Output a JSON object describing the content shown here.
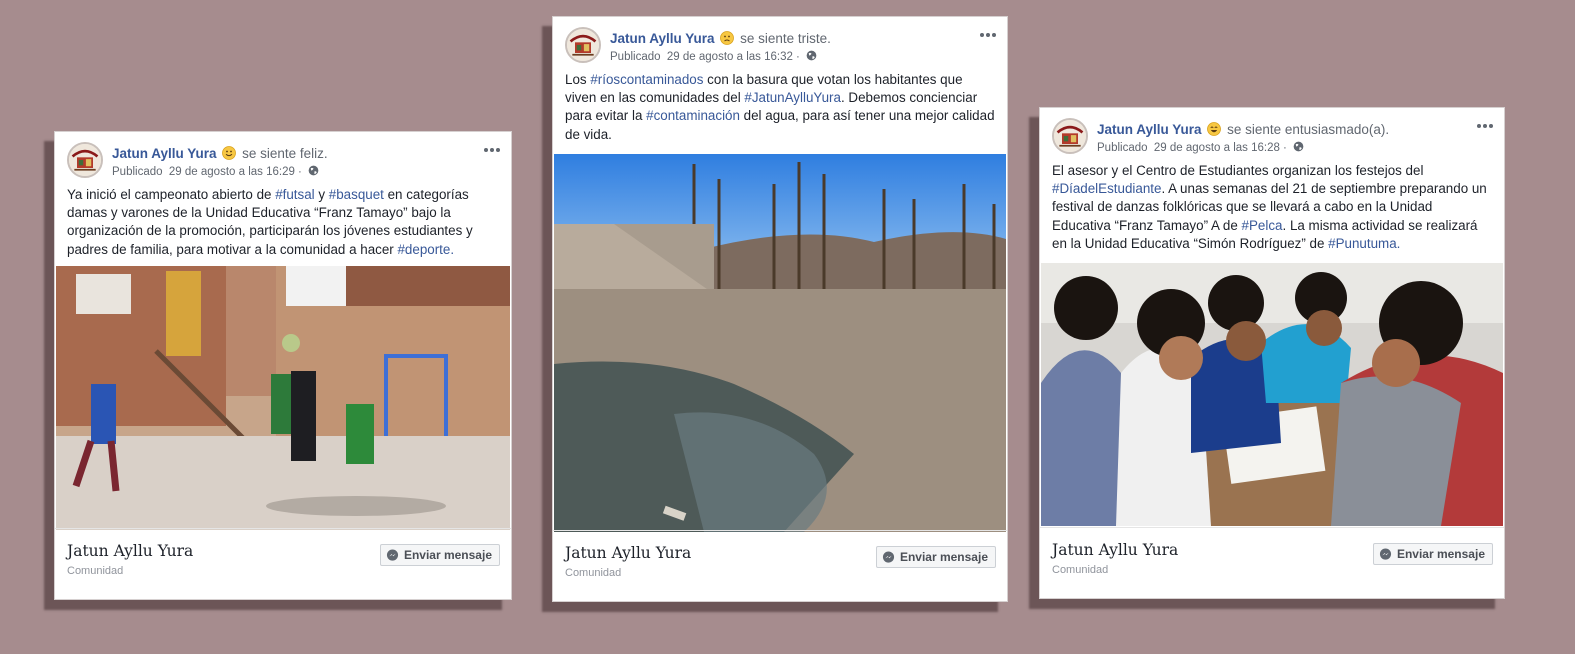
{
  "posts": [
    {
      "page_name": "Jatun Ayllu Yura",
      "feeling": "se siente feliz.",
      "feeling_icon": "happy-emoji-icon",
      "published_label": "Publicado",
      "timestamp": "29 de agosto a las 16:29 ·",
      "text": [
        {
          "t": "Ya inició el campeonato abierto de "
        },
        {
          "t": "#futsal",
          "tag": true
        },
        {
          "t": " y "
        },
        {
          "t": "#basquet",
          "tag": true
        },
        {
          "t": " en categorías damas y varones de la Unidad Educativa “Franz Tamayo” bajo la organización de la promoción, participarán los jóvenes estudiantes y padres de familia, para motivar a la comunidad a hacer "
        },
        {
          "t": "#deporte.",
          "tag": true
        }
      ],
      "footer_name": "Jatun Ayllu Yura",
      "footer_sub": "Comunidad",
      "button_label": "Enviar mensaje"
    },
    {
      "page_name": "Jatun Ayllu Yura",
      "feeling": "se siente triste.",
      "feeling_icon": "sad-emoji-icon",
      "published_label": "Publicado",
      "timestamp": "29 de agosto a las 16:32 ·",
      "text": [
        {
          "t": "Los "
        },
        {
          "t": "#ríoscontaminados",
          "tag": true
        },
        {
          "t": " con la basura que votan los habitantes que viven en las comunidades del "
        },
        {
          "t": "#JatunAylluYura",
          "tag": true
        },
        {
          "t": ". Debemos concienciar para evitar la "
        },
        {
          "t": "#contaminación",
          "tag": true
        },
        {
          "t": " del agua, para así tener una mejor calidad de vida."
        }
      ],
      "footer_name": "Jatun Ayllu Yura",
      "footer_sub": "Comunidad",
      "button_label": "Enviar mensaje"
    },
    {
      "page_name": "Jatun Ayllu Yura",
      "feeling": "se siente entusiasmado(a).",
      "feeling_icon": "excited-emoji-icon",
      "published_label": "Publicado",
      "timestamp": "29 de agosto a las 16:28 ·",
      "text": [
        {
          "t": "El asesor y el Centro de Estudiantes organizan los festejos del "
        },
        {
          "t": "#DíadelEstudiante",
          "tag": true
        },
        {
          "t": ". A unas semanas del 21 de septiembre preparando un festival de danzas folklóricas que se llevará a cabo en la Unidad Educativa “Franz Tamayo” A de "
        },
        {
          "t": "#Pelca",
          "tag": true
        },
        {
          "t": ". La misma actividad se realizará en la Unidad Educativa “Simón Rodríguez” de "
        },
        {
          "t": "#Punutuma.",
          "tag": true
        }
      ],
      "footer_name": "Jatun Ayllu Yura",
      "footer_sub": "Comunidad",
      "button_label": "Enviar mensaje"
    }
  ],
  "colors": {
    "background": "#a68c8e",
    "link": "#385898",
    "text": "#1d2129",
    "meta": "#616770"
  }
}
